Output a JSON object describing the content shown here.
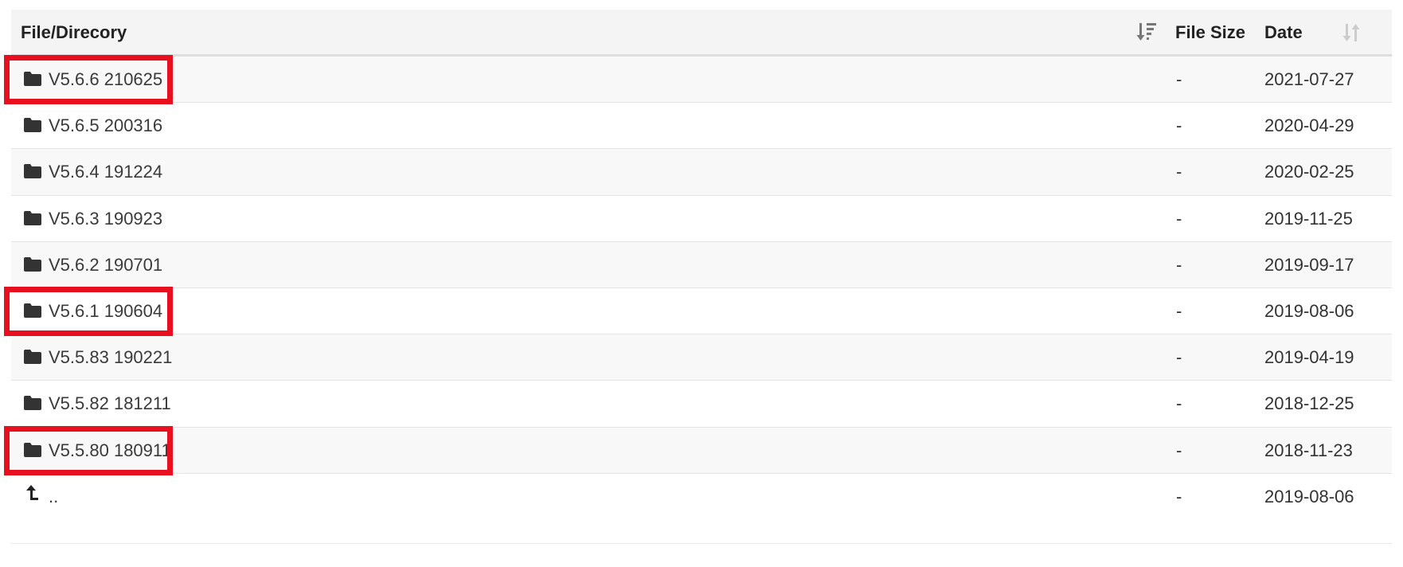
{
  "header": {
    "name_label": "File/Direcory",
    "size_label": "File Size",
    "date_label": "Date",
    "name_sort_icon": "sort-amount-down-icon",
    "date_sort_icon": "sort-both-icon"
  },
  "rows": [
    {
      "name": "V5.6.6 210625",
      "size": "-",
      "date": "2021-07-27",
      "icon": "folder-icon",
      "highlighted": true
    },
    {
      "name": "V5.6.5 200316",
      "size": "-",
      "date": "2020-04-29",
      "icon": "folder-icon",
      "highlighted": false
    },
    {
      "name": "V5.6.4 191224",
      "size": "-",
      "date": "2020-02-25",
      "icon": "folder-icon",
      "highlighted": false
    },
    {
      "name": "V5.6.3 190923",
      "size": "-",
      "date": "2019-11-25",
      "icon": "folder-icon",
      "highlighted": false
    },
    {
      "name": "V5.6.2 190701",
      "size": "-",
      "date": "2019-09-17",
      "icon": "folder-icon",
      "highlighted": false
    },
    {
      "name": "V5.6.1 190604",
      "size": "-",
      "date": "2019-08-06",
      "icon": "folder-icon",
      "highlighted": true
    },
    {
      "name": "V5.5.83 190221",
      "size": "-",
      "date": "2019-04-19",
      "icon": "folder-icon",
      "highlighted": false
    },
    {
      "name": "V5.5.82 181211",
      "size": "-",
      "date": "2018-12-25",
      "icon": "folder-icon",
      "highlighted": false
    },
    {
      "name": "V5.5.80 180911",
      "size": "-",
      "date": "2018-11-23",
      "icon": "folder-icon",
      "highlighted": true
    }
  ],
  "parent_row": {
    "name": "..",
    "size": "-",
    "date": "2019-08-06",
    "icon": "level-up-icon"
  },
  "colors": {
    "highlight": "#e8101e",
    "icon": "#333333",
    "sort_active": "#777777",
    "sort_inactive": "#cccccc"
  }
}
